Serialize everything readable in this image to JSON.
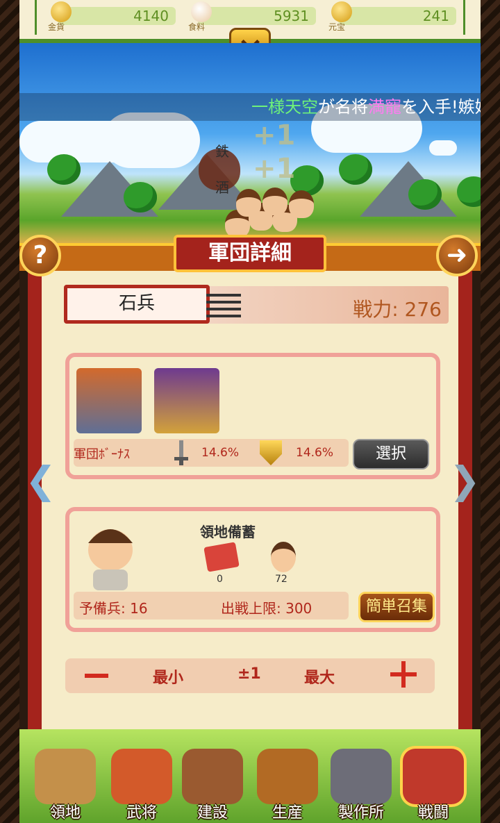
{
  "resources": [
    {
      "label": "金貨",
      "value": "4140",
      "icon": "gold-coin-icon"
    },
    {
      "label": "食料",
      "value": "5931",
      "icon": "food-bun-icon"
    },
    {
      "label": "元宝",
      "value": "241",
      "icon": "ingot-icon"
    }
  ],
  "ticker": {
    "player": "一様天空",
    "middle": "が名将",
    "hero": "満寵",
    "tail": "を入手!嫉妬"
  },
  "float_texts": {
    "plus1": "+1",
    "plus2": "+1",
    "item1": "鉄",
    "item2": "酒"
  },
  "panel": {
    "title": "軍団詳細",
    "help": "?",
    "unit_name": "石兵",
    "power": "戦力: 276",
    "bonus_label": "軍団ﾎﾞｰﾅｽ",
    "attack_bonus": "14.6%",
    "defense_bonus": "14.6%",
    "select_button": "選択",
    "reserve_title": "領地備蓄",
    "brick_count": "0",
    "villager_count": "72",
    "reserve_soldiers": "予備兵: 16",
    "battle_cap": "出戦上限: 300",
    "easy_recruit": "簡単召集",
    "min": "最小",
    "step": "±1",
    "max": "最大",
    "minus": "一"
  },
  "nav": [
    {
      "label": "領地",
      "icon": "territory-icon",
      "color": "#c4904a"
    },
    {
      "label": "武将",
      "icon": "general-icon",
      "color": "#d35a2a"
    },
    {
      "label": "建設",
      "icon": "build-hammer-icon",
      "color": "#9a5a30"
    },
    {
      "label": "生産",
      "icon": "production-barrel-icon",
      "color": "#b26a24"
    },
    {
      "label": "製作所",
      "icon": "workshop-anvil-icon",
      "color": "#6d6d78"
    },
    {
      "label": "戦闘",
      "icon": "battle-helmet-icon",
      "color": "#c0392b"
    }
  ]
}
